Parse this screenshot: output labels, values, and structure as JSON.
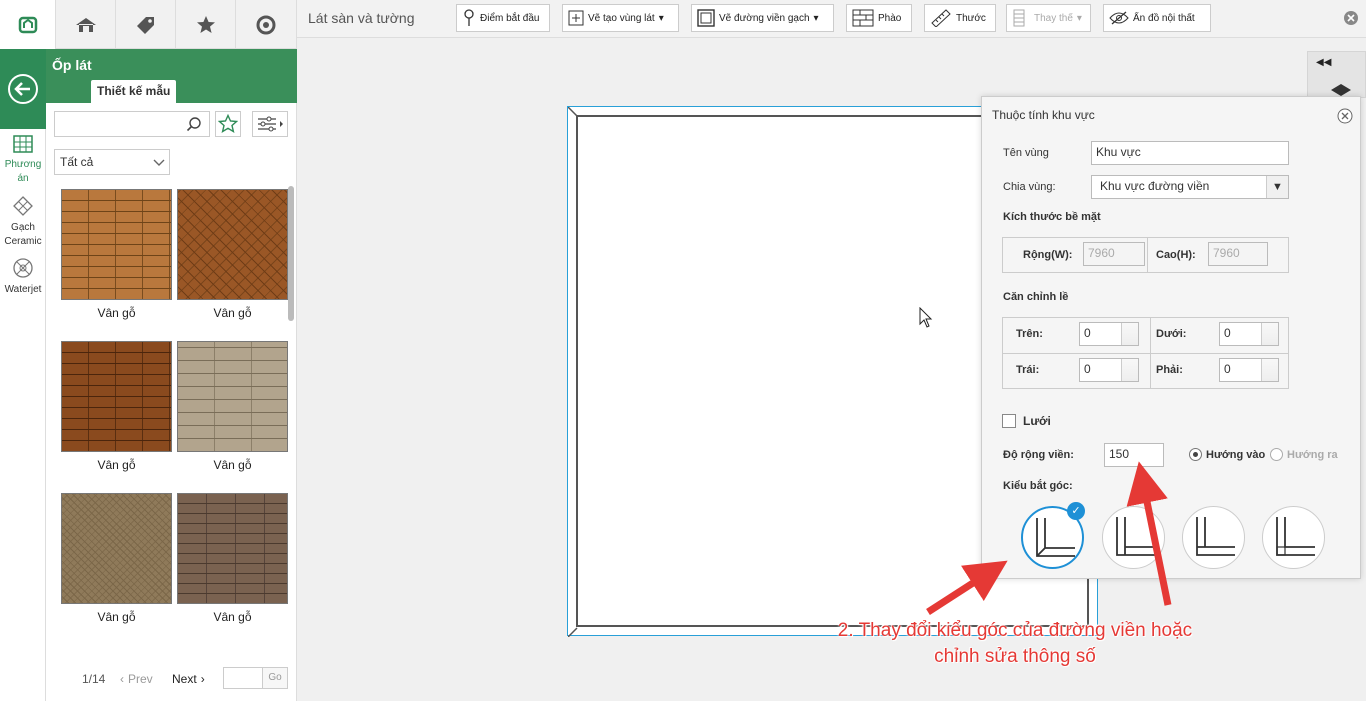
{
  "colors": {
    "brand_green": "#2e8b57",
    "accent_blue": "#1e90d6",
    "arrow_red": "#e53935"
  },
  "topnav": [
    {
      "icon": "logo-icon"
    },
    {
      "icon": "house-icon"
    },
    {
      "icon": "tag-icon"
    },
    {
      "icon": "star-icon"
    },
    {
      "icon": "compass-icon"
    }
  ],
  "rail": {
    "items": [
      {
        "icon": "grid-icon",
        "label": "Phương án"
      },
      {
        "icon": "diamond-tile-icon",
        "label": "Gạch Ceramic"
      },
      {
        "icon": "waterjet-icon",
        "label": "Waterjet"
      }
    ]
  },
  "panel": {
    "title": "Ốp lát",
    "tab": "Thiết kế mẫu",
    "search_value": "",
    "filter_value": "Tất cả",
    "tiles": [
      {
        "label": "Vân gỗ"
      },
      {
        "label": "Vân gỗ"
      },
      {
        "label": "Vân gỗ"
      },
      {
        "label": "Vân gỗ"
      },
      {
        "label": "Vân gỗ"
      },
      {
        "label": "Vân gỗ"
      }
    ],
    "pagination": {
      "page": "1/14",
      "prev": "Prev",
      "next": "Next",
      "go": "Go",
      "input": ""
    }
  },
  "toolbar": {
    "title": "Lát sàn và tường",
    "buttons": [
      {
        "label": "Điểm bắt đầu"
      },
      {
        "label": "Vẽ tạo vùng lát"
      },
      {
        "label": "Vẽ đường viền gạch"
      },
      {
        "label": "Phào"
      },
      {
        "label": "Thước"
      },
      {
        "label": "Thay thế"
      },
      {
        "label": "Ẩn đồ nội thất"
      }
    ]
  },
  "dialog": {
    "title": "Thuộc tính khu vực",
    "name_label": "Tên vùng",
    "name_value": "Khu vực",
    "split_label": "Chia vùng:",
    "split_value": "Khu vực đường viền",
    "size_heading": "Kích thước bề mặt",
    "width_label": "Rộng(W):",
    "width_value": "7960",
    "height_label": "Cao(H):",
    "height_value": "7960",
    "align_heading": "Căn chỉnh lề",
    "top_label": "Trên:",
    "top_value": "0",
    "bottom_label": "Dưới:",
    "bottom_value": "0",
    "left_label": "Trái:",
    "left_value": "0",
    "right_label": "Phải:",
    "right_value": "0",
    "grid_label": "Lưới",
    "border_width_label": "Độ rộng viền:",
    "border_width_value": "150",
    "inward_label": "Hướng vào",
    "outward_label": "Hướng ra",
    "corner_label": "Kiểu bắt góc:"
  },
  "annotation": {
    "line1": "2. Thay đổi kiểu góc của đường viền hoặc",
    "line2": "chỉnh sửa thông số"
  }
}
